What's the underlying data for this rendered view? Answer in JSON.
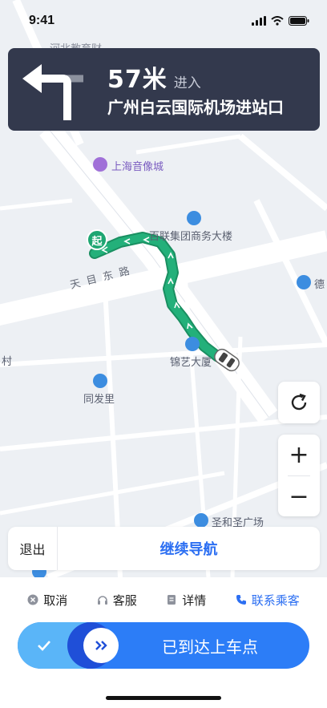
{
  "status": {
    "time": "9:41"
  },
  "nav": {
    "distance": "57米",
    "action": "进入",
    "road": "广州白云国际机场进站口"
  },
  "map": {
    "labels": {
      "top_partial": "河北教育财",
      "shanghai_audio": "上海音像城",
      "bailian": "百联集团商务大楼",
      "tianmu_road": "天目东路",
      "de_partial": "德",
      "cun_partial": "村",
      "jinyi": "锦艺大厦",
      "tongfa": "同发里",
      "shenghe": "圣和圣广场"
    },
    "start_marker": "起"
  },
  "controls": {
    "zoom_in": "+",
    "zoom_out": "−"
  },
  "action_bar": {
    "exit": "退出",
    "continue": "继续导航"
  },
  "tools": {
    "cancel": "取消",
    "service": "客服",
    "details": "详情",
    "contact": "联系乘客"
  },
  "arrive": {
    "label": "已到达上车点"
  },
  "colors": {
    "route": "#1ea672",
    "primary": "#2c6ff2",
    "nav_bg": "#33394d"
  }
}
